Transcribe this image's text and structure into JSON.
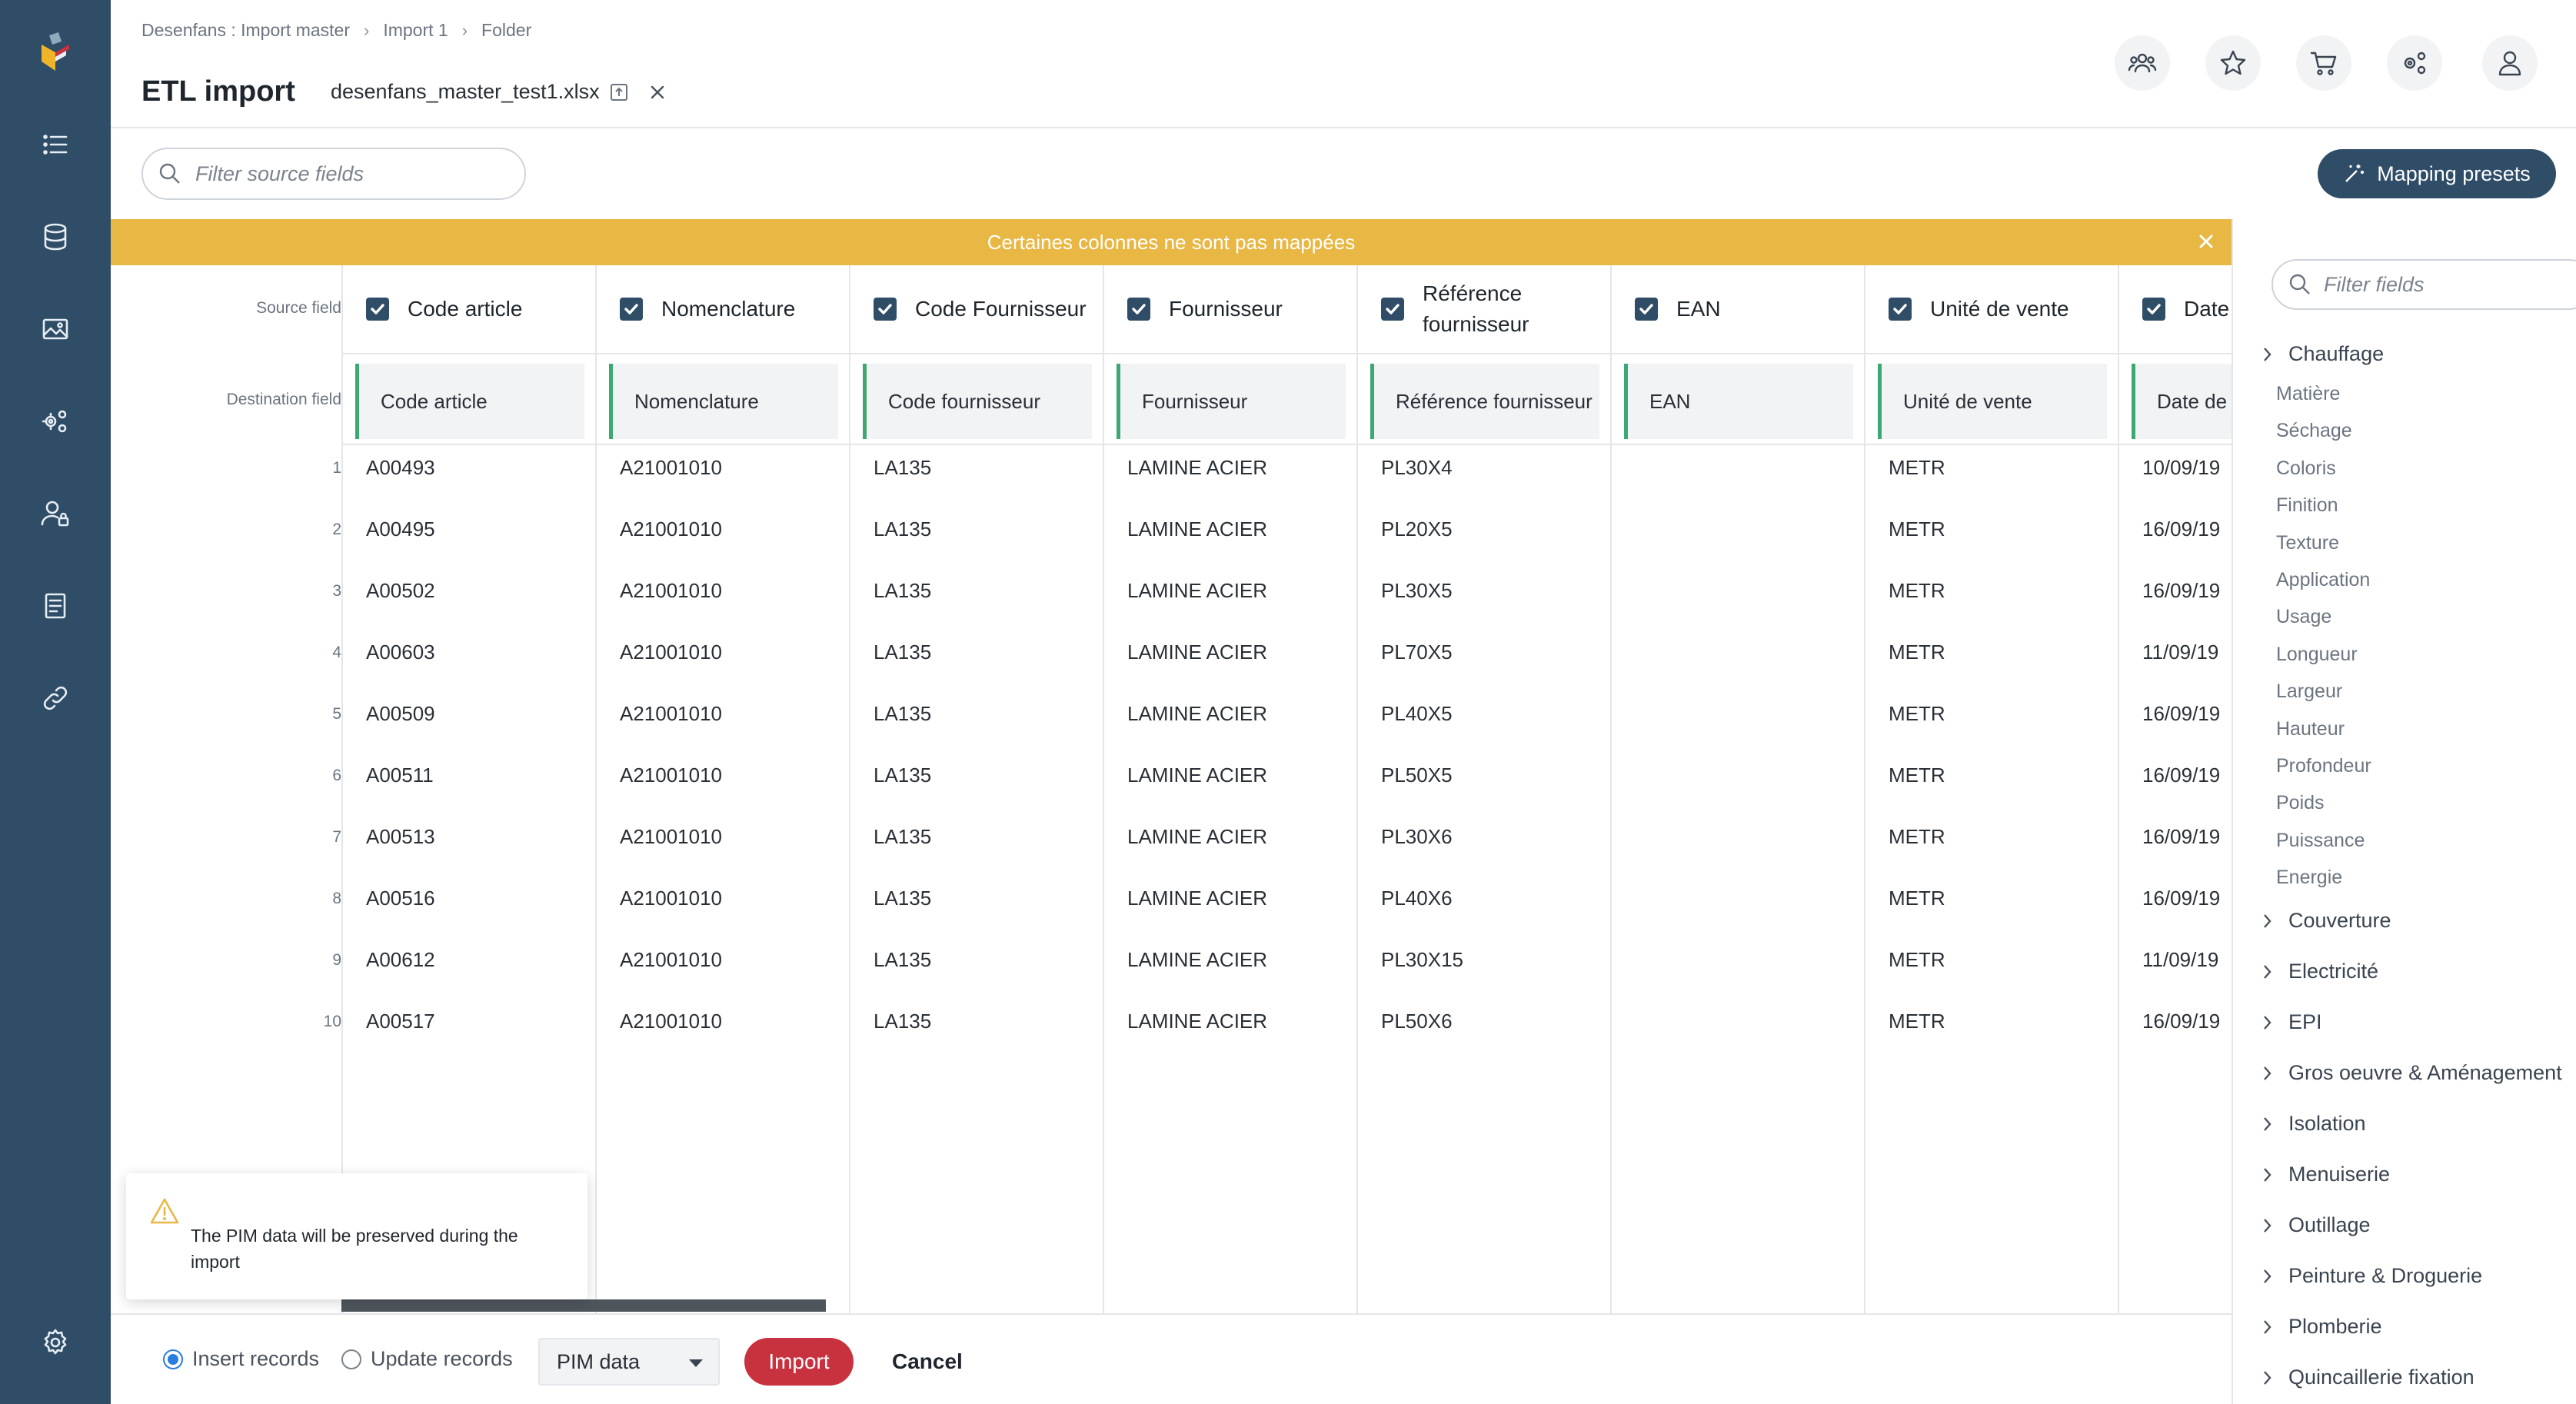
{
  "breadcrumb": [
    "Desenfans : Import master",
    "Import 1",
    "Folder"
  ],
  "page_title": "ETL import",
  "file_name": "desenfans_master_test1.xlsx",
  "search_source": {
    "placeholder": "Filter source fields"
  },
  "mapping_presets_label": "Mapping presets",
  "banner_text": "Certaines colonnes ne sont pas mappées",
  "labels": {
    "source_field": "Source field",
    "destination_field": "Destination field"
  },
  "columns": [
    {
      "source": "Code article",
      "destination": "Code article",
      "values": [
        "A00493",
        "A00495",
        "A00502",
        "A00603",
        "A00509",
        "A00511",
        "A00513",
        "A00516",
        "A00612",
        "A00517"
      ]
    },
    {
      "source": "Nomenclature",
      "destination": "Nomenclature",
      "values": [
        "A21001010",
        "A21001010",
        "A21001010",
        "A21001010",
        "A21001010",
        "A21001010",
        "A21001010",
        "A21001010",
        "A21001010",
        "A21001010"
      ]
    },
    {
      "source": "Code Fournisseur",
      "destination": "Code fournisseur",
      "values": [
        "LA135",
        "LA135",
        "LA135",
        "LA135",
        "LA135",
        "LA135",
        "LA135",
        "LA135",
        "LA135",
        "LA135"
      ]
    },
    {
      "source": "Fournisseur",
      "destination": "Fournisseur",
      "values": [
        "LAMINE ACIER",
        "LAMINE ACIER",
        "LAMINE ACIER",
        "LAMINE ACIER",
        "LAMINE ACIER",
        "LAMINE ACIER",
        "LAMINE ACIER",
        "LAMINE ACIER",
        "LAMINE ACIER",
        "LAMINE ACIER"
      ]
    },
    {
      "source": "Référence fournisseur",
      "destination": "Référence fournisseur",
      "values": [
        "PL30X4",
        "PL20X5",
        "PL30X5",
        "PL70X5",
        "PL40X5",
        "PL50X5",
        "PL30X6",
        "PL40X6",
        "PL30X15",
        "PL50X6"
      ]
    },
    {
      "source": "EAN",
      "destination": "EAN",
      "values": [
        "",
        "",
        "",
        "",
        "",
        "",
        "",
        "",
        "",
        ""
      ]
    },
    {
      "source": "Unité de vente",
      "destination": "Unité de vente",
      "values": [
        "METR",
        "METR",
        "METR",
        "METR",
        "METR",
        "METR",
        "METR",
        "METR",
        "METR",
        "METR"
      ]
    },
    {
      "source": "Date",
      "destination": "Date de",
      "values": [
        "10/09/19",
        "16/09/19",
        "16/09/19",
        "11/09/19",
        "16/09/19",
        "16/09/19",
        "16/09/19",
        "16/09/19",
        "11/09/19",
        "16/09/19"
      ]
    }
  ],
  "row_numbers": [
    "1",
    "2",
    "3",
    "4",
    "5",
    "6",
    "7",
    "8",
    "9",
    "10"
  ],
  "toast_message": "The PIM data will be preserved during the import",
  "footer": {
    "insert_label": "Insert records",
    "update_label": "Update records",
    "select_value": "PIM data",
    "import_label": "Import",
    "cancel_label": "Cancel"
  },
  "search_fields": {
    "placeholder": "Filter fields"
  },
  "tree": {
    "chauffage": "Chauffage",
    "chauffage_children": [
      "Matière",
      "Séchage",
      "Coloris",
      "Finition",
      "Texture",
      "Application",
      "Usage",
      "Longueur",
      "Largeur",
      "Hauteur",
      "Profondeur",
      "Poids",
      "Puissance",
      "Energie"
    ],
    "groups": [
      "Couverture",
      "Electricité",
      "EPI",
      "Gros oeuvre & Aménagement",
      "Isolation",
      "Menuiserie",
      "Outillage",
      "Peinture & Droguerie",
      "Plomberie",
      "Quincaillerie fixation"
    ]
  },
  "colors": {
    "sidebar": "#2f4d67",
    "banner": "#e9b744",
    "import": "#c8323e",
    "mapped": "#3fa773"
  }
}
